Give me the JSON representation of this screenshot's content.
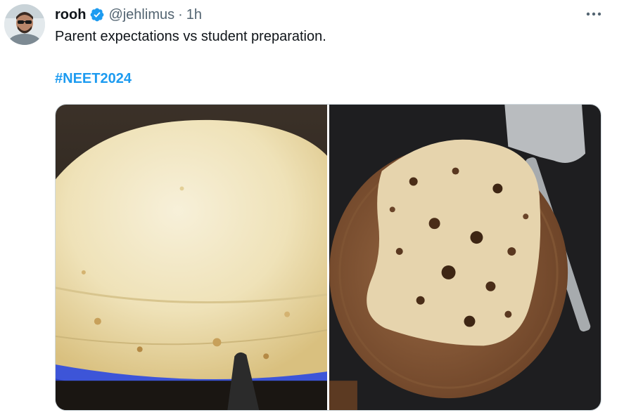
{
  "tweet": {
    "author": {
      "display_name": "rooh",
      "handle": "@jehlimus",
      "separator": "·",
      "time": "1h",
      "verified": true,
      "verified_icon": "verified-badge-icon"
    },
    "more_icon": "more-horizontal-icon",
    "text": "Parent expectations vs student preparation.",
    "hashtag": "#NEET2024",
    "media": [
      {
        "name": "media-image-puffed-roti",
        "icon": "photo"
      },
      {
        "name": "media-image-flat-roti",
        "icon": "photo"
      }
    ]
  },
  "colors": {
    "text": "#0f1419",
    "secondary": "#536471",
    "link": "#1d9bf0",
    "verified": "#1d9bf0",
    "border": "#cfd9de"
  }
}
